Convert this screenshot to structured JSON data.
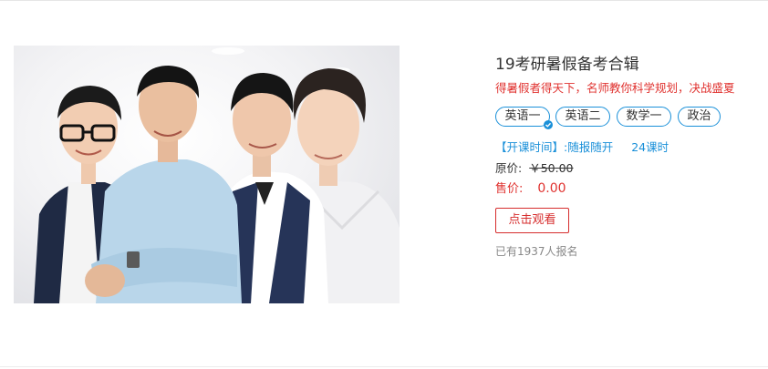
{
  "course": {
    "title": "19考研暑假备考合辑",
    "subtitle": "得暑假者得天下，名师教你科学规划，决战盛夏",
    "tags": [
      {
        "label": "英语一",
        "selected": true
      },
      {
        "label": "英语二",
        "selected": false
      },
      {
        "label": "数学一",
        "selected": false
      },
      {
        "label": "政治",
        "selected": false
      }
    ],
    "schedule_label": "【开课时间】:",
    "schedule_value": "随报随开",
    "hours": "24课时",
    "original_price_label": "原价:",
    "original_price": "￥50.00",
    "sale_price_label": "售价:",
    "sale_price": "0.00",
    "watch_button": "点击观看",
    "enrollment": "已有1937人报名"
  },
  "colors": {
    "accent_blue": "#1a90d9",
    "accent_red": "#e0322f",
    "button_red": "#d62d2d"
  }
}
